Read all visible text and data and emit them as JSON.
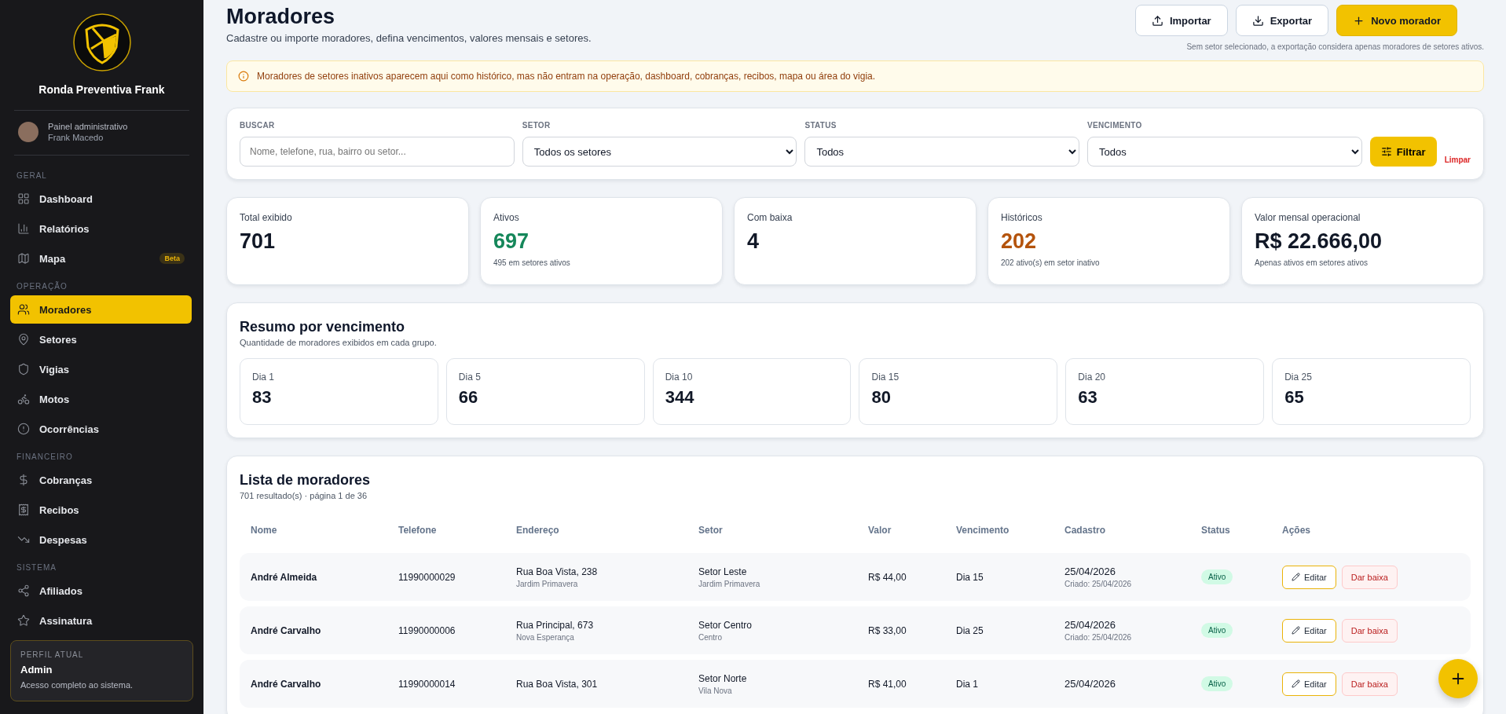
{
  "sidebar": {
    "brand": "Ronda Preventiva Frank",
    "user": {
      "role": "Painel administrativo",
      "name": "Frank Macedo"
    },
    "sections": [
      {
        "title": "GERAL",
        "items": [
          {
            "label": "Dashboard",
            "selected": false
          },
          {
            "label": "Relatórios",
            "selected": false
          },
          {
            "label": "Mapa",
            "selected": false,
            "badge": "Beta"
          }
        ]
      },
      {
        "title": "OPERAÇÃO",
        "items": [
          {
            "label": "Moradores",
            "selected": true
          },
          {
            "label": "Setores",
            "selected": false
          },
          {
            "label": "Vigias",
            "selected": false
          },
          {
            "label": "Motos",
            "selected": false
          },
          {
            "label": "Ocorrências",
            "selected": false
          }
        ]
      },
      {
        "title": "FINANCEIRO",
        "items": [
          {
            "label": "Cobranças",
            "selected": false
          },
          {
            "label": "Recibos",
            "selected": false
          },
          {
            "label": "Despesas",
            "selected": false
          }
        ]
      },
      {
        "title": "SISTEMA",
        "items": [
          {
            "label": "Afiliados",
            "selected": false
          },
          {
            "label": "Assinatura",
            "selected": false
          }
        ]
      }
    ],
    "profile": {
      "heading": "PERFIL ATUAL",
      "name": "Admin",
      "description": "Acesso completo ao sistema."
    }
  },
  "header": {
    "title": "Moradores",
    "subtitle": "Cadastre ou importe moradores, defina vencimentos, valores mensais e setores.",
    "buttons": [
      {
        "label": "Importar",
        "kind": "import"
      },
      {
        "label": "Exportar",
        "kind": "export"
      },
      {
        "label": "Novo morador",
        "kind": "primary"
      }
    ],
    "note": "Sem setor selecionado, a exportação considera apenas moradores de setores ativos."
  },
  "alert": "Moradores de setores inativos aparecem aqui como histórico, mas não entram na operação, dashboard, cobranças, recibos, mapa ou área do vigia.",
  "filters": {
    "fields": [
      {
        "label": "BUSCAR",
        "kind": "input",
        "placeholder": "Nome, telefone, rua, bairro ou setor..."
      },
      {
        "label": "SETOR",
        "kind": "select",
        "value": "Todos os setores"
      },
      {
        "label": "STATUS",
        "kind": "select",
        "value": "Todos"
      },
      {
        "label": "VENCIMENTO",
        "kind": "select",
        "value": "Todos"
      }
    ],
    "button": "Filtrar",
    "clear": "Limpar"
  },
  "stats": [
    {
      "label": "Total exibido",
      "value": "701",
      "color": "#111827"
    },
    {
      "label": "Ativos",
      "value": "697",
      "note": "495 em setores ativos",
      "color": "#15875a"
    },
    {
      "label": "Com baixa",
      "value": "4",
      "color": "#111827"
    },
    {
      "label": "Históricos",
      "value": "202",
      "note": "202 ativo(s) em setor inativo",
      "color": "#b4530c"
    },
    {
      "label": "Valor mensal operacional",
      "value": "R$ 22.666,00",
      "note": "Apenas ativos em setores ativos",
      "color": "#111827"
    }
  ],
  "summary": {
    "title": "Resumo por vencimento",
    "subtitle": "Quantidade de moradores exibidos em cada grupo.",
    "items": [
      {
        "label": "Dia 1",
        "value": "83"
      },
      {
        "label": "Dia 5",
        "value": "66"
      },
      {
        "label": "Dia 10",
        "value": "344"
      },
      {
        "label": "Dia 15",
        "value": "80"
      },
      {
        "label": "Dia 20",
        "value": "63"
      },
      {
        "label": "Dia 25",
        "value": "65"
      }
    ]
  },
  "list": {
    "title": "Lista de moradores",
    "meta": "701 resultado(s) · página 1 de 36",
    "columns": [
      "Nome",
      "Telefone",
      "Endereço",
      "Setor",
      "Valor",
      "Vencimento",
      "Cadastro",
      "Status",
      "Ações"
    ],
    "rows": [
      {
        "name": "André Almeida",
        "phone": "11990000029",
        "address": "Rua Boa Vista, 238",
        "address_sub": "Jardim Primavera",
        "sector": "Setor Leste",
        "sector_sub": "Jardim Primavera",
        "value": "R$ 44,00",
        "due": "Dia 15",
        "date": "25/04/2026",
        "created": "Criado: 25/04/2026",
        "status": "Ativo",
        "active": true,
        "actions": [
          "Editar",
          "Dar baixa"
        ]
      },
      {
        "name": "André Carvalho",
        "phone": "11990000006",
        "address": "Rua Principal, 673",
        "address_sub": "Nova Esperança",
        "sector": "Setor Centro",
        "sector_sub": "Centro",
        "value": "R$ 33,00",
        "due": "Dia 25",
        "date": "25/04/2026",
        "created": "Criado: 25/04/2026",
        "status": "Ativo",
        "active": true,
        "actions": [
          "Editar",
          "Dar baixa"
        ]
      },
      {
        "name": "André Carvalho",
        "phone": "11990000014",
        "address": "Rua Boa Vista, 301",
        "sector": "Setor Norte",
        "sector_sub": "Vila Nova",
        "value": "R$ 41,00",
        "due": "Dia 1",
        "date": "25/04/2026",
        "status": "Ativo",
        "active": true,
        "actions": [
          "Editar",
          "Dar baixa"
        ]
      }
    ]
  }
}
